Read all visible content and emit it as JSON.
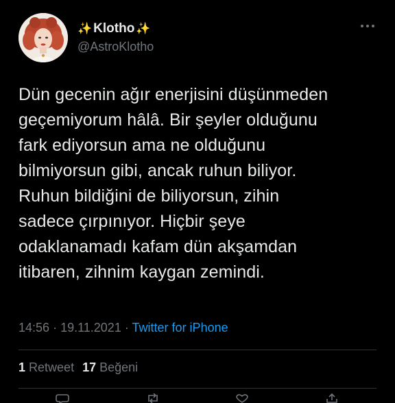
{
  "author": {
    "display_name": "Klotho",
    "sparkle_left": "✨",
    "sparkle_right": "✨",
    "handle": "@AstroKlotho"
  },
  "tweet": {
    "text": "Dün gecenin ağır enerjisini düşünmeden\ngeçemiyorum hâlâ. Bir şeyler olduğunu\nfark ediyorsun ama ne olduğunu\nbilmiyorsun gibi, ancak ruhun biliyor.\nRuhun bildiğini de biliyorsun, zihin\nsadece çırpınıyor. Hiçbir şeye\nodaklanamadı kafam dün akşamdan\nitibaren, zihnim kaygan zemindi.",
    "time": "14:56",
    "separator": "·",
    "date": "19.11.2021",
    "source": "Twitter for iPhone"
  },
  "stats": {
    "retweet_count": "1",
    "retweet_label": "Retweet",
    "like_count": "17",
    "like_label": "Beğeni"
  },
  "colors": {
    "background": "#000000",
    "text": "#e7e9ea",
    "muted": "#71767b",
    "link": "#1d9bf0",
    "divider": "#2f3336"
  },
  "icons": {
    "more": "more-horizontal-icon",
    "reply": "reply-icon",
    "retweet": "retweet-icon",
    "like": "heart-icon",
    "share": "share-icon"
  }
}
